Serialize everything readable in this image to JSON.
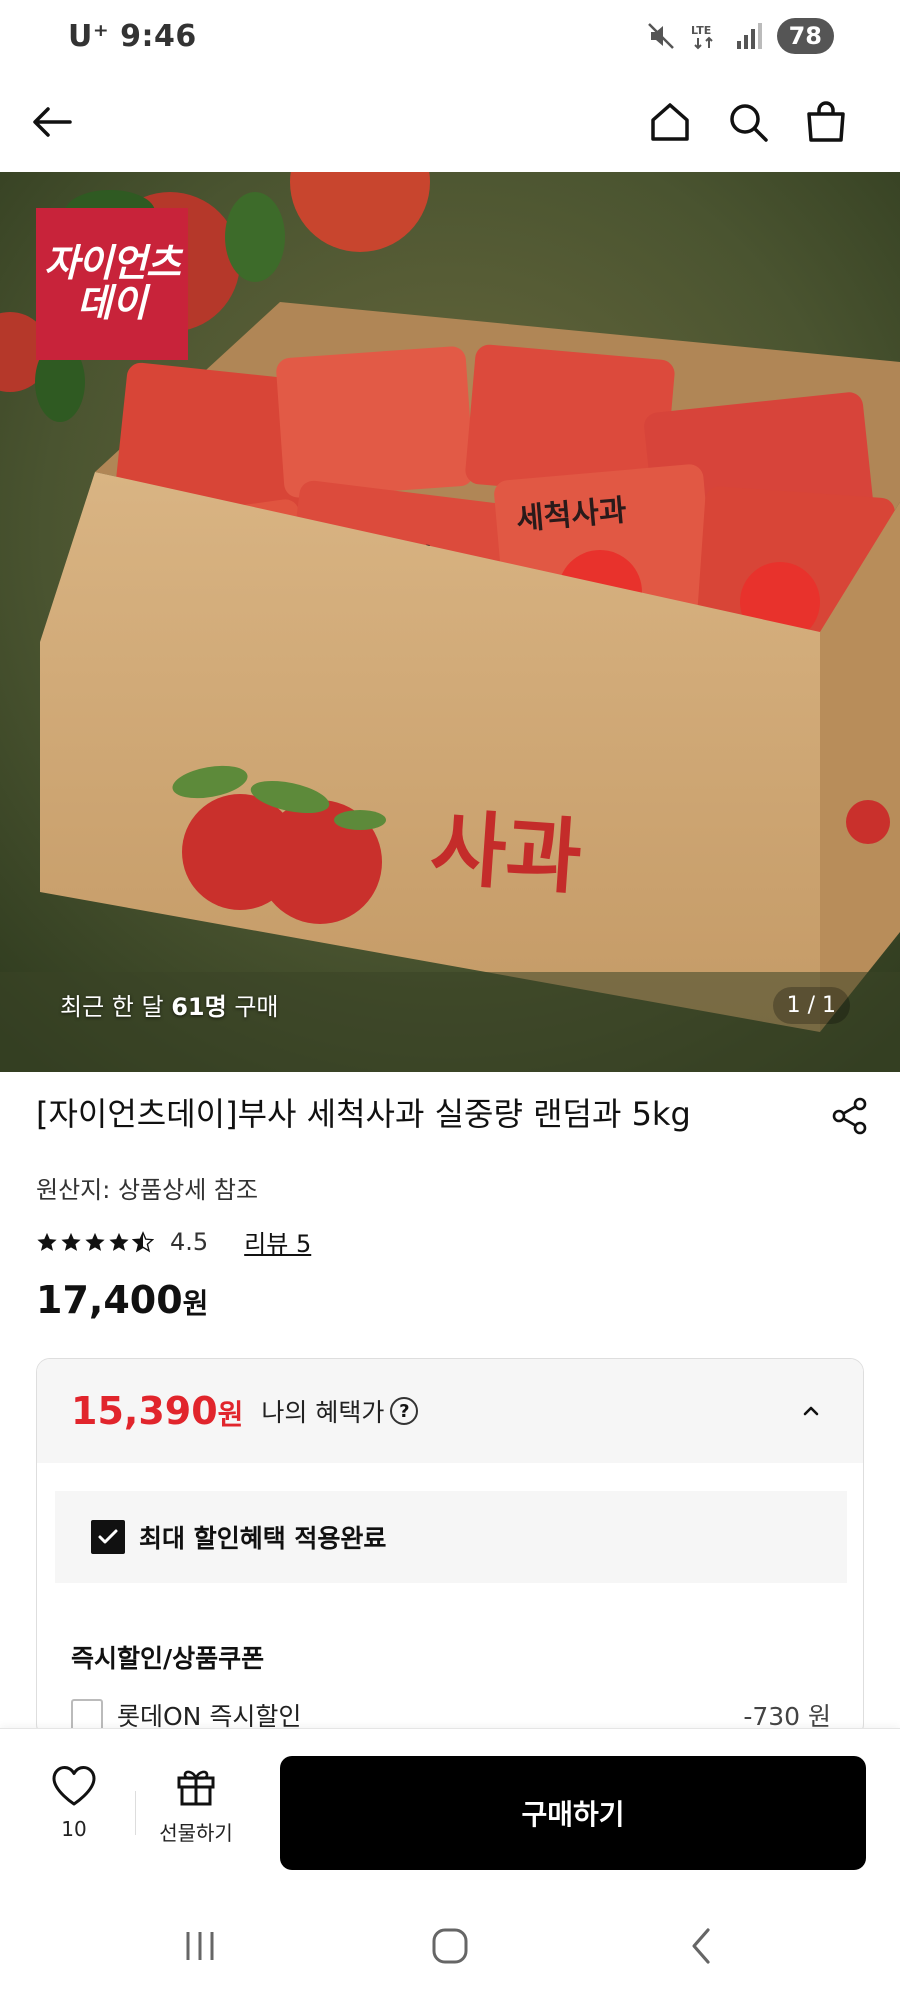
{
  "status_bar": {
    "carrier": "U⁺ 9:46",
    "network": "LTE",
    "battery": "78",
    "icons": [
      "mute-icon",
      "lte-icon",
      "signal-icon",
      "battery-icon"
    ]
  },
  "top_nav": {
    "icons": [
      "back-arrow-icon",
      "home-icon",
      "search-icon",
      "shopping-bag-icon"
    ]
  },
  "hero": {
    "brand_badge": {
      "line1": "자이언츠",
      "line2": "데이"
    },
    "purchase_prefix": "최근 한 달 ",
    "purchase_count": "61명",
    "purchase_suffix": " 구매",
    "image_counter": "1 / 1",
    "box_text": "사과",
    "pack_text": "세척사과"
  },
  "product": {
    "title": "[자이언츠데이]부사 세척사과 실중량 랜덤과 5kg",
    "origin": "원산지: 상품상세 참조",
    "rating": "4.5",
    "rating_value": 4.5,
    "review_link": "리뷰 5",
    "price": "17,400",
    "price_unit": "원"
  },
  "benefit": {
    "price": "15,390",
    "price_unit": "원",
    "label": "나의 혜택가",
    "help": "?",
    "applied_text": "최대 할인혜택 적용완료",
    "coupon_heading": "즉시할인/상품쿠폰",
    "coupon_label": "롯데ON 즉시할인",
    "coupon_amount": "-730 원"
  },
  "action_bar": {
    "wish_count": "10",
    "gift_label": "선물하기",
    "buy_label": "구매하기"
  },
  "colors": {
    "accent_red": "#e1252c",
    "brand_red": "#c8233a",
    "buy_button": "#000000"
  }
}
